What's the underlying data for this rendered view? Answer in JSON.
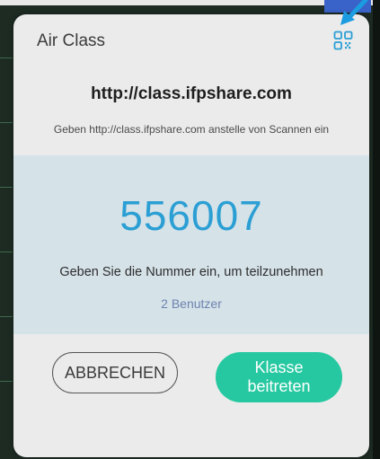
{
  "dialog": {
    "title": "Air Class",
    "qr_icon": "qr-code-icon",
    "url": "http://class.ifpshare.com",
    "url_hint": "Geben http://class.ifpshare.com anstelle von Scannen ein",
    "code": "556007",
    "instruction": "Geben Sie die Nummer ein, um teilzunehmen",
    "user_count": "2 Benutzer",
    "cancel_label": "ABBRECHEN",
    "join_label": "Klasse beitreten"
  },
  "colors": {
    "accent": "#2b9fd4",
    "join_button": "#25c8a0",
    "panel": "#d5e2e8",
    "user_count": "#6e83b0",
    "arrow": "#1b9be0"
  }
}
